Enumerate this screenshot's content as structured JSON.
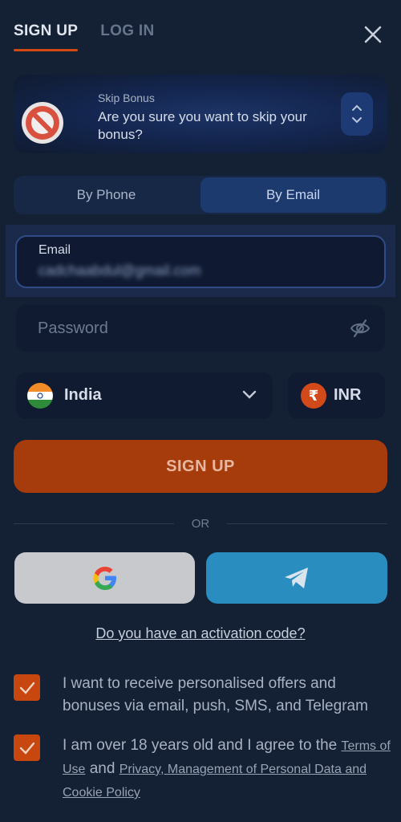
{
  "tabs": {
    "signup": "SIGN UP",
    "login": "LOG IN"
  },
  "bonus": {
    "kicker": "Skip Bonus",
    "title": "Are you sure you want to skip your bonus?"
  },
  "methods": {
    "phone": "By Phone",
    "email": "By Email",
    "selected": "By Email"
  },
  "email": {
    "label": "Email",
    "value": "cadchaabdul@gmail.com"
  },
  "password": {
    "placeholder": "Password"
  },
  "country": {
    "value": "India"
  },
  "currency": {
    "value": "INR",
    "symbol": "₹"
  },
  "signup_button": "SIGN UP",
  "or_text": "OR",
  "activation_link": "Do you have an activation code?",
  "consents": {
    "offers": {
      "text": "I want to receive personalised offers and bonuses via email, push, SMS, and Telegram",
      "checked": true
    },
    "age": {
      "text_before": "I am over 18 years old and I agree to the",
      "terms_link": "Terms of Use",
      "and": "and",
      "privacy_link": "Privacy, Management of Personal Data and Cookie Policy",
      "checked": true
    }
  },
  "colors": {
    "accent": "#d24a12",
    "background": "#142033",
    "telegram": "#2a8dc0"
  }
}
